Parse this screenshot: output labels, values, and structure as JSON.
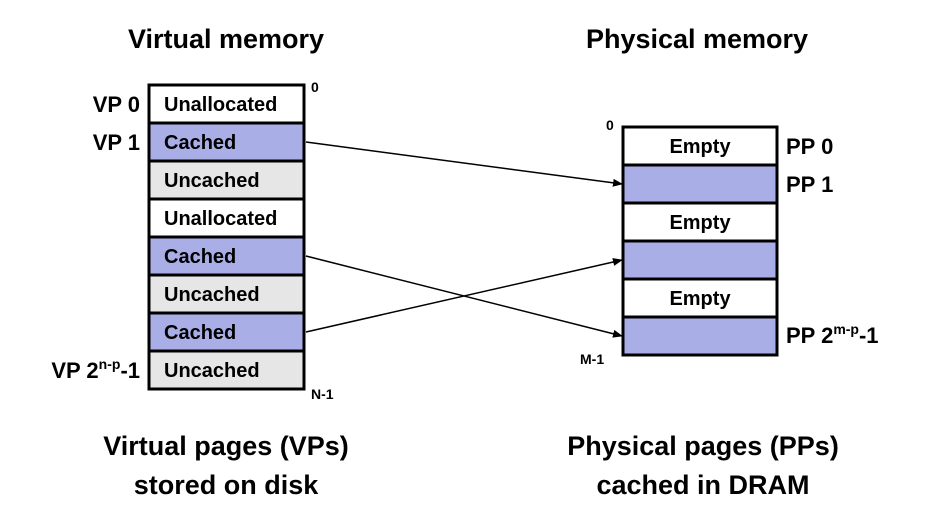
{
  "virtual": {
    "title": "Virtual memory",
    "caption_line1": "Virtual pages (VPs)",
    "caption_line2": "stored on disk",
    "addr_start": "0",
    "addr_end": "N-1",
    "labels": {
      "vp0": "VP 0",
      "vp1": "VP 1",
      "vplast_base": "VP 2",
      "vplast_exp": "n-p",
      "vplast_suffix": "-1"
    },
    "rows": [
      {
        "text": "Unallocated",
        "state": "unallocated"
      },
      {
        "text": "Cached",
        "state": "cached"
      },
      {
        "text": "Uncached",
        "state": "uncached"
      },
      {
        "text": "Unallocated",
        "state": "unallocated"
      },
      {
        "text": "Cached",
        "state": "cached"
      },
      {
        "text": "Uncached",
        "state": "uncached"
      },
      {
        "text": "Cached",
        "state": "cached"
      },
      {
        "text": "Uncached",
        "state": "uncached"
      }
    ]
  },
  "physical": {
    "title": "Physical memory",
    "caption_line1": "Physical pages (PPs)",
    "caption_line2": "cached in DRAM",
    "addr_start": "0",
    "addr_end": "M-1",
    "labels": {
      "pp0": "PP 0",
      "pp1": "PP 1",
      "pplast_base": "PP 2",
      "pplast_exp": "m-p",
      "pplast_suffix": "-1"
    },
    "rows": [
      {
        "text": "Empty",
        "state": "empty"
      },
      {
        "text": "",
        "state": "cached"
      },
      {
        "text": "Empty",
        "state": "empty"
      },
      {
        "text": "",
        "state": "cached"
      },
      {
        "text": "Empty",
        "state": "empty"
      },
      {
        "text": "",
        "state": "cached"
      }
    ]
  },
  "mappings": [
    {
      "from_vp_row": 1,
      "to_pp_row": 1
    },
    {
      "from_vp_row": 4,
      "to_pp_row": 5
    },
    {
      "from_vp_row": 6,
      "to_pp_row": 3
    }
  ],
  "colors": {
    "cached": "#aaaee6",
    "uncached": "#e6e6e6",
    "unallocated": "#ffffff",
    "empty": "#ffffff",
    "border": "#000000"
  }
}
